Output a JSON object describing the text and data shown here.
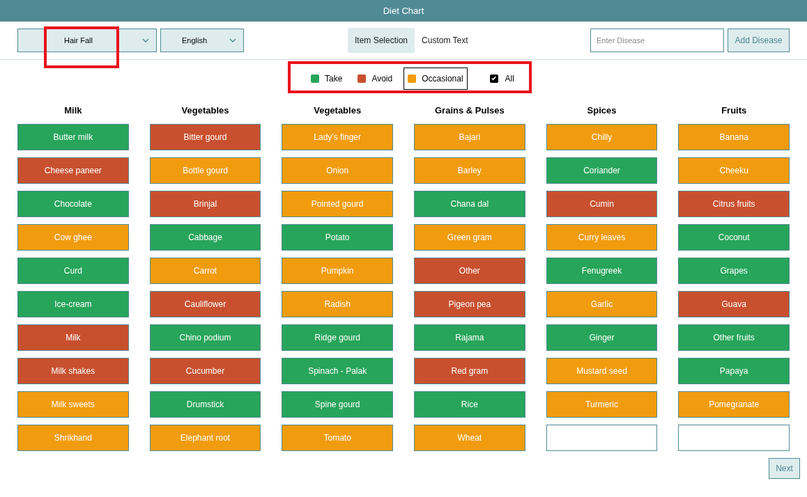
{
  "window": {
    "title": "Diet Chart"
  },
  "toolbar": {
    "disease_select": "Hair Fall",
    "language_select": "English",
    "tabs": [
      {
        "label": "Item Selection",
        "selected": true
      },
      {
        "label": "Custom Text",
        "selected": false
      }
    ],
    "disease_input": {
      "placeholder": "Enter Disease"
    },
    "add_button": "Add Disease"
  },
  "legend": [
    {
      "label": "Take",
      "color": "#27a55a",
      "selected": false
    },
    {
      "label": "Avoid",
      "color": "#c9502f",
      "selected": false
    },
    {
      "label": "Occasional",
      "color": "#f19c0e",
      "selected": true
    }
  ],
  "all_filter": {
    "label": "All",
    "checked": true
  },
  "columns": [
    {
      "title": "Milk",
      "items": [
        {
          "label": "Butter milk",
          "kind": "take"
        },
        {
          "label": "Cheese paneer",
          "kind": "avoid"
        },
        {
          "label": "Chocolate",
          "kind": "take"
        },
        {
          "label": "Cow ghee",
          "kind": "occasional"
        },
        {
          "label": "Curd",
          "kind": "take"
        },
        {
          "label": "Ice-cream",
          "kind": "take"
        },
        {
          "label": "Milk",
          "kind": "avoid"
        },
        {
          "label": "Milk shakes",
          "kind": "avoid"
        },
        {
          "label": "Milk sweets",
          "kind": "occasional"
        },
        {
          "label": "Shrikhand",
          "kind": "occasional"
        }
      ]
    },
    {
      "title": "Vegetables",
      "items": [
        {
          "label": "Bitter gourd",
          "kind": "avoid"
        },
        {
          "label": "Bottle gourd",
          "kind": "occasional"
        },
        {
          "label": "Brinjal",
          "kind": "avoid"
        },
        {
          "label": "Cabbage",
          "kind": "take"
        },
        {
          "label": "Carrot",
          "kind": "occasional"
        },
        {
          "label": "Cauliflower",
          "kind": "avoid"
        },
        {
          "label": "Chino podium",
          "kind": "take"
        },
        {
          "label": "Cucumber",
          "kind": "avoid"
        },
        {
          "label": "Drumstick",
          "kind": "take"
        },
        {
          "label": "Elephant root",
          "kind": "occasional"
        }
      ]
    },
    {
      "title": "Vegetables",
      "items": [
        {
          "label": "Lady's finger",
          "kind": "occasional"
        },
        {
          "label": "Onion",
          "kind": "occasional"
        },
        {
          "label": "Pointed gourd",
          "kind": "occasional"
        },
        {
          "label": "Potato",
          "kind": "take"
        },
        {
          "label": "Pumpkin",
          "kind": "occasional"
        },
        {
          "label": "Radish",
          "kind": "occasional"
        },
        {
          "label": "Ridge gourd",
          "kind": "take"
        },
        {
          "label": "Spinach - Palak",
          "kind": "take"
        },
        {
          "label": "Spine gourd",
          "kind": "take"
        },
        {
          "label": "Tomato",
          "kind": "occasional"
        }
      ]
    },
    {
      "title": "Grains & Pulses",
      "items": [
        {
          "label": "Bajari",
          "kind": "occasional"
        },
        {
          "label": "Barley",
          "kind": "occasional"
        },
        {
          "label": "Chana dal",
          "kind": "take"
        },
        {
          "label": "Green gram",
          "kind": "occasional"
        },
        {
          "label": "Other",
          "kind": "avoid"
        },
        {
          "label": "Pigeon pea",
          "kind": "avoid"
        },
        {
          "label": "Rajama",
          "kind": "take"
        },
        {
          "label": "Red gram",
          "kind": "avoid"
        },
        {
          "label": "Rice",
          "kind": "take"
        },
        {
          "label": "Wheat",
          "kind": "occasional"
        }
      ]
    },
    {
      "title": "Spices",
      "items": [
        {
          "label": "Chilly",
          "kind": "occasional"
        },
        {
          "label": "Coriander",
          "kind": "take"
        },
        {
          "label": "Cumin",
          "kind": "avoid"
        },
        {
          "label": "Curry leaves",
          "kind": "occasional"
        },
        {
          "label": "Fenugreek",
          "kind": "take"
        },
        {
          "label": "Garlic",
          "kind": "occasional"
        },
        {
          "label": "Ginger",
          "kind": "take"
        },
        {
          "label": "Mustard seed",
          "kind": "occasional"
        },
        {
          "label": "Turmeric",
          "kind": "occasional"
        },
        {
          "kind": "empty"
        }
      ]
    },
    {
      "title": "Fruits",
      "items": [
        {
          "label": "Banana",
          "kind": "occasional"
        },
        {
          "label": "Cheeku",
          "kind": "occasional"
        },
        {
          "label": "Citrus fruits",
          "kind": "avoid"
        },
        {
          "label": "Coconut",
          "kind": "take"
        },
        {
          "label": "Grapes",
          "kind": "take"
        },
        {
          "label": "Guava",
          "kind": "avoid"
        },
        {
          "label": "Other fruits",
          "kind": "take"
        },
        {
          "label": "Papaya",
          "kind": "take"
        },
        {
          "label": "Pomegranate",
          "kind": "occasional"
        },
        {
          "kind": "empty"
        }
      ]
    }
  ],
  "next_button": "Next"
}
